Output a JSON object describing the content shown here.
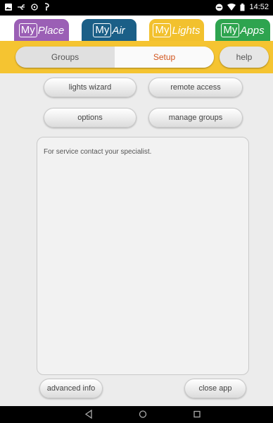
{
  "status_bar": {
    "time": "14:52"
  },
  "app_tabs": [
    {
      "prefix": "My",
      "suffix": "Place",
      "color": "#9b5fb5"
    },
    {
      "prefix": "My",
      "suffix": "Air",
      "color": "#1b5f87"
    },
    {
      "prefix": "My",
      "suffix": "Lights",
      "color": "#f2c12e"
    },
    {
      "prefix": "My",
      "suffix": "Apps",
      "color": "#2ea44f"
    }
  ],
  "accent_color": "#f5c431",
  "sub_tabs": {
    "groups": "Groups",
    "setup": "Setup",
    "help": "help"
  },
  "buttons": {
    "lights_wizard": "lights wizard",
    "remote_access": "remote access",
    "options": "options",
    "manage_groups": "manage groups",
    "advanced_info": "advanced info",
    "close_app": "close app"
  },
  "info_panel": {
    "text": "For service contact your specialist."
  }
}
